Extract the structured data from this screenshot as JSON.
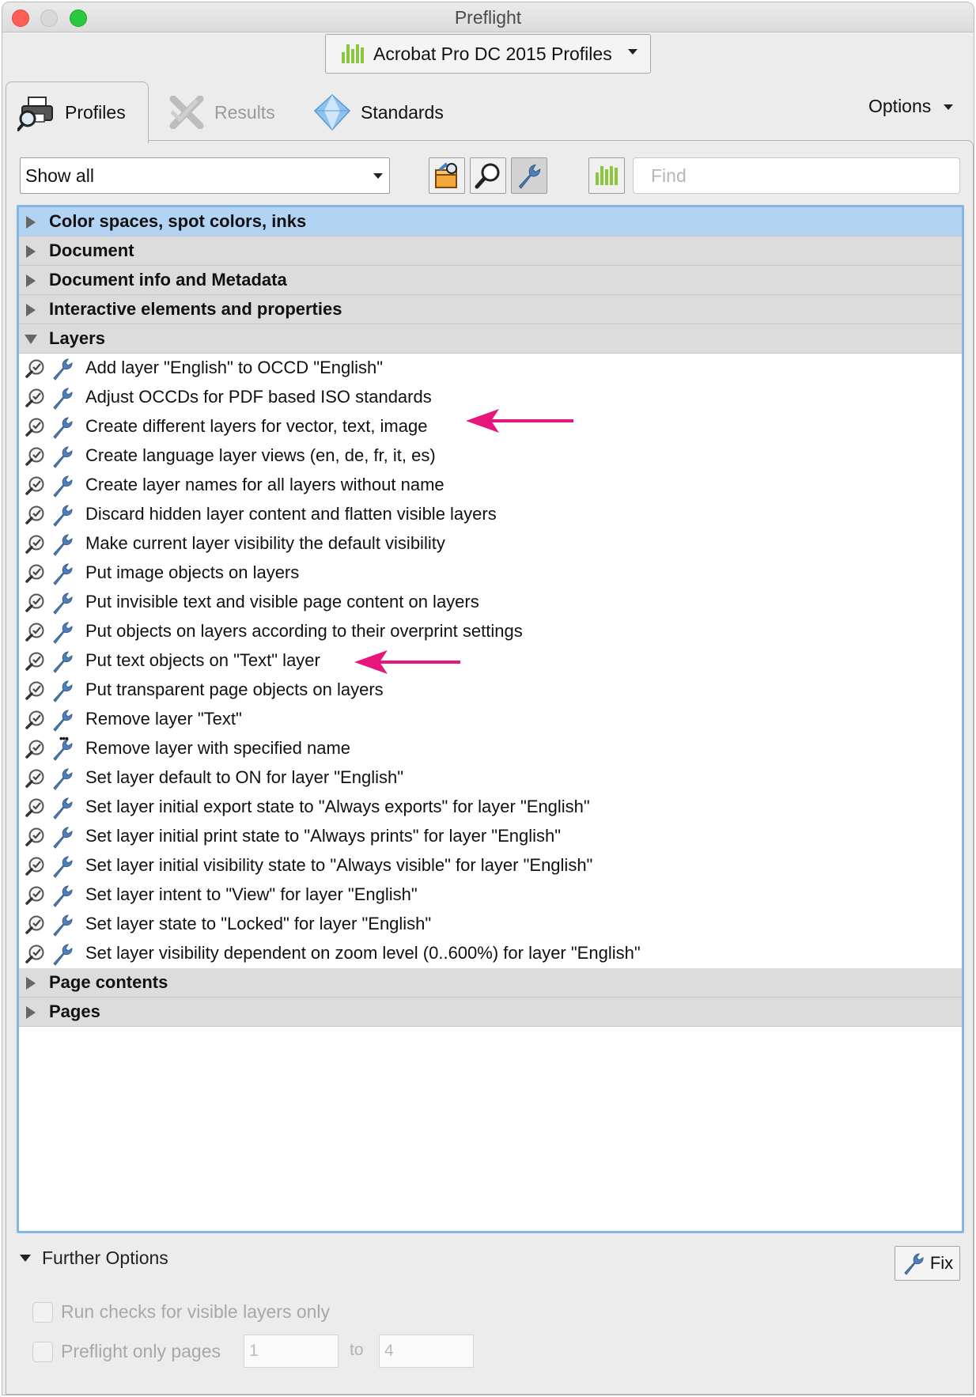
{
  "window": {
    "title": "Preflight"
  },
  "profile_select": {
    "value": "Acrobat Pro DC 2015 Profiles"
  },
  "tabs": [
    {
      "label": "Profiles",
      "active": true
    },
    {
      "label": "Results",
      "disabled": true
    },
    {
      "label": "Standards"
    }
  ],
  "options_label": "Options",
  "filter": {
    "value": "Show all"
  },
  "search": {
    "placeholder": "Find"
  },
  "categories": [
    {
      "label": "Color spaces, spot colors, inks"
    },
    {
      "label": "Document"
    },
    {
      "label": "Document info and Metadata"
    },
    {
      "label": "Interactive elements and properties"
    },
    {
      "label": "Layers"
    },
    {
      "label": "Page contents"
    },
    {
      "label": "Pages"
    }
  ],
  "layer_items": [
    "Add layer \"English\" to OCCD \"English\"",
    "Adjust OCCDs for PDF based ISO standards",
    "Create different layers for vector, text, image",
    "Create language layer views (en, de, fr, it, es)",
    "Create layer names for all layers without name",
    "Discard hidden layer content and flatten visible layers",
    "Make current layer visibility the default visibility",
    "Put image objects on layers",
    "Put invisible text and visible page content on layers",
    "Put objects on layers according to their overprint settings",
    "Put text objects on \"Text\" layer",
    "Put transparent page objects on layers",
    "Remove layer \"Text\"",
    "Remove layer with specified name",
    "Set layer default to ON for layer \"English\"",
    "Set layer initial export state to \"Always exports\" for layer \"English\"",
    "Set layer initial print state to \"Always prints\" for layer \"English\"",
    "Set layer initial visibility state to \"Always visible\" for layer \"English\"",
    "Set layer intent to \"View\" for layer \"English\"",
    "Set layer state to \"Locked\" for layer \"English\"",
    "Set layer visibility dependent on zoom level (0..600%) for layer \"English\""
  ],
  "further_options": {
    "label": "Further Options",
    "fix_label": "Fix",
    "visible_layers_only": "Run checks for visible layers only",
    "preflight_only_pages": "Preflight only pages",
    "page_from": "1",
    "to_label": "to",
    "page_to": "4"
  },
  "colors": {
    "accent_selection": "#b2d4f2",
    "annotation_arrow": "#e8157a",
    "profile_green": "#8cc63f",
    "wrench_blue": "#4f7fb8"
  }
}
